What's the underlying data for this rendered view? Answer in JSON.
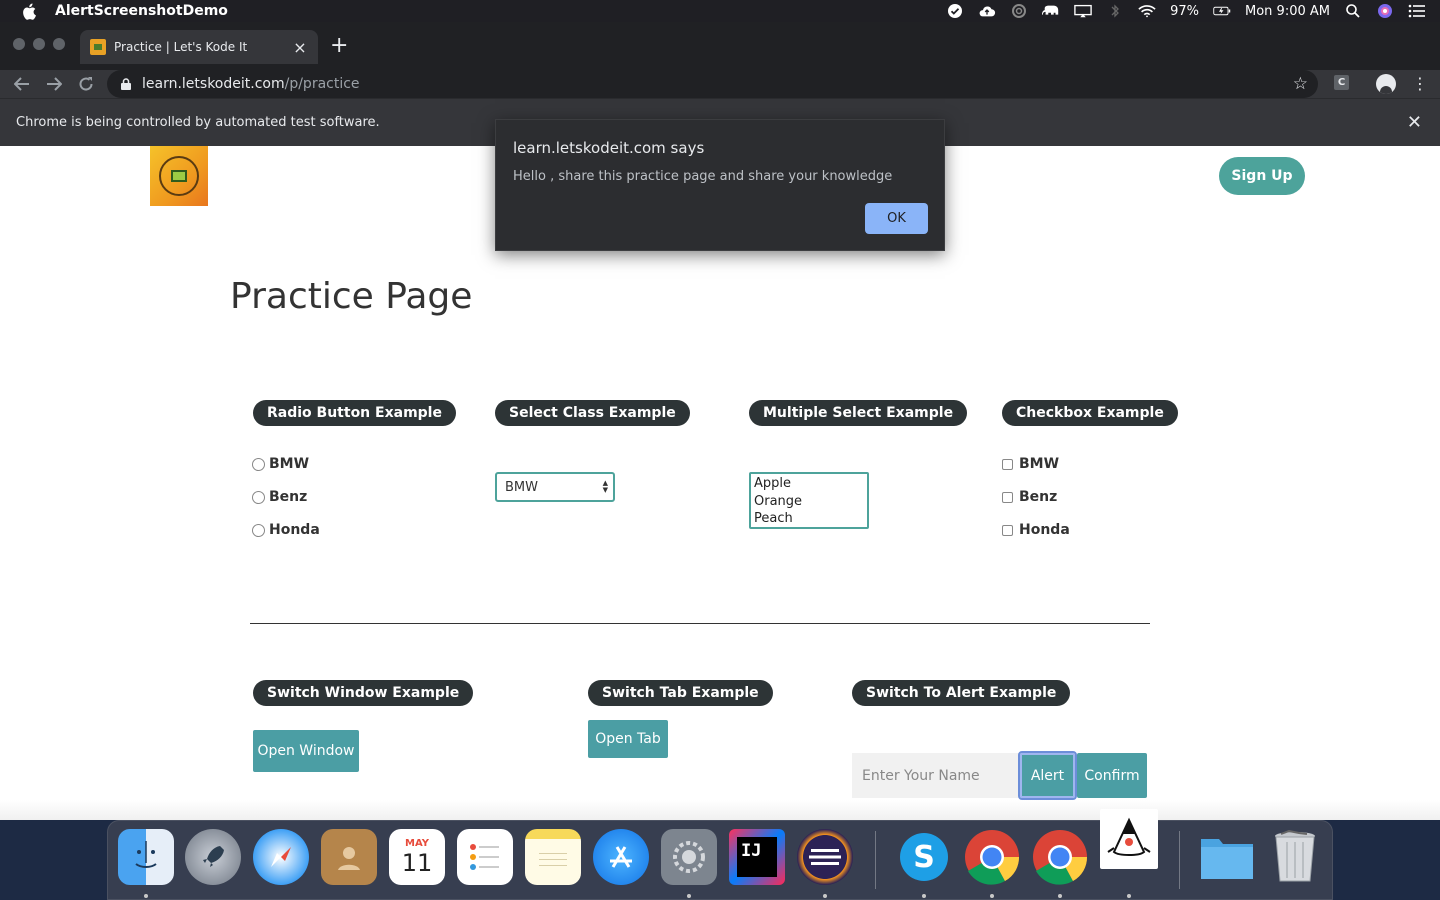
{
  "menubar": {
    "app_name": "AlertScreenshotDemo",
    "battery": "97%",
    "clock": "Mon 9:00 AM"
  },
  "browser": {
    "tab_title": "Practice | Let's Kode It",
    "tab_close": "×",
    "new_tab": "+",
    "url_host": "learn.letskodeit.com",
    "url_path": "/p/practice",
    "extension_label": "C",
    "infobar_message": "Chrome is being controlled by automated test software.",
    "infobar_close": "✕"
  },
  "dialog": {
    "title": "learn.letskodeit.com says",
    "message": "Hello , share this practice page and share your knowledge",
    "ok_label": "OK"
  },
  "page": {
    "signup_label": "Sign Up",
    "title": "Practice Page",
    "radio_section": {
      "label": "Radio Button Example",
      "options": [
        "BMW",
        "Benz",
        "Honda"
      ]
    },
    "select_section": {
      "label": "Select Class Example",
      "selected": "BMW"
    },
    "multi_select_section": {
      "label": "Multiple Select Example",
      "options": [
        "Apple",
        "Orange",
        "Peach"
      ]
    },
    "checkbox_section": {
      "label": "Checkbox Example",
      "options": [
        "BMW",
        "Benz",
        "Honda"
      ]
    },
    "switch_window": {
      "label": "Switch Window Example",
      "button": "Open Window"
    },
    "switch_tab": {
      "label": "Switch Tab Example",
      "button": "Open Tab"
    },
    "switch_alert": {
      "label": "Switch To Alert Example",
      "placeholder": "Enter Your Name",
      "alert_button": "Alert",
      "confirm_button": "Confirm"
    }
  },
  "dock": {
    "calendar_month": "MAY",
    "calendar_day": "11",
    "intellij_label": "IJ",
    "skype_label": "S"
  },
  "colors": {
    "accent_teal": "#4da39b",
    "button_teal": "#4b9ea4",
    "pill_dark": "#2d3436",
    "dialog_ok": "#8ab4f8"
  }
}
